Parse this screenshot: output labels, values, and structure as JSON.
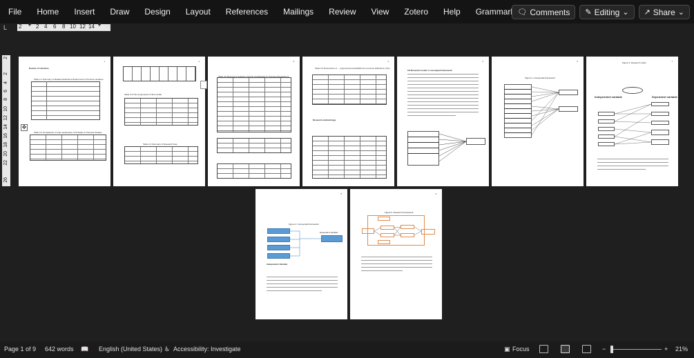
{
  "ribbon": {
    "tabs": [
      "File",
      "Home",
      "Insert",
      "Draw",
      "Design",
      "Layout",
      "References",
      "Mailings",
      "Review",
      "View",
      "Zotero",
      "Help",
      "Grammarly"
    ],
    "comments_label": "Comments",
    "editing_label": "Editing",
    "share_label": "Share"
  },
  "ruler": {
    "tab_selector": "L",
    "h_numbers": [
      "2",
      "2",
      "4",
      "6",
      "8",
      "10",
      "12",
      "14",
      "18"
    ],
    "v_numbers": [
      "2",
      "2",
      "4",
      "6",
      "8",
      "10",
      "12",
      "14",
      "16",
      "18",
      "20",
      "22",
      "26"
    ]
  },
  "status": {
    "page": "Page 1 of 9",
    "words": "642 words",
    "language": "English (United States)",
    "accessibility": "Accessibility: Investigate",
    "focus": "Focus",
    "zoom": "21%",
    "zoom_level_percent": 21
  },
  "pages": {
    "p1_title": "Review of Literature",
    "p1_table_title": "Table 2.1 Summary of Related Definitions Referenced in Previous Literature",
    "p1_table2_title": "Table 2.2 Comparison of main perspective of Scholars in Previous Studies",
    "p2_table_title": "Table 2.3 The components of SLA model",
    "p2_table2_title": "Table 2.4 Summary of Research Gap",
    "p3_table_title": "Table 2.5 Resources Selection Criteria Investigated by Previous Researchers",
    "p4_title": "Table 2.6 Dimensions of ... proposed and established in previous definitions of the",
    "p4_sub": "Research methodology",
    "p5_title": "2.8 Research model or conceptual framework",
    "p6_title": "Figure 2. Conceptual Framework",
    "p7_title": "Figure 3. Research model",
    "p7_left": "Independent variable",
    "p7_right": "Dependent variable",
    "p8_title": "Figure 4. Conceptual Framework",
    "p8_dep": "Dependent Variable",
    "p8_ind": "Independent Variable",
    "p9_title": "Figure 5. Research Framework"
  }
}
